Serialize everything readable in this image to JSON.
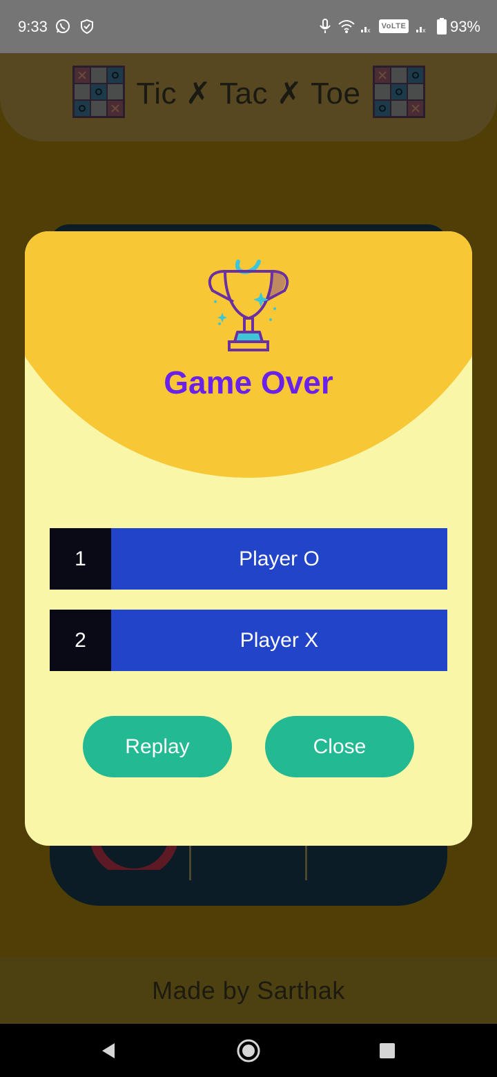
{
  "status_bar": {
    "time": "9:33",
    "network_badge": "VoLTE",
    "battery_percent": "93%",
    "icons": [
      "whatsapp-icon",
      "shield-icon",
      "microphone-icon",
      "wifi-icon",
      "signal-icon",
      "battery-icon"
    ]
  },
  "header": {
    "title": "Tic ✗ Tac ✗ Toe"
  },
  "dialog": {
    "title": "Game Over",
    "rankings": [
      {
        "rank": "1",
        "player": "Player O"
      },
      {
        "rank": "2",
        "player": "Player X"
      }
    ],
    "replay_label": "Replay",
    "close_label": "Close"
  },
  "footer": {
    "text": "Made by Sarthak"
  },
  "colors": {
    "dialog_bg": "#f9f6a8",
    "dialog_arc": "#f8c736",
    "title": "#6a22e8",
    "rank_row": "#2244c8",
    "rank_num": "#0a0a16",
    "button": "#22b993"
  }
}
